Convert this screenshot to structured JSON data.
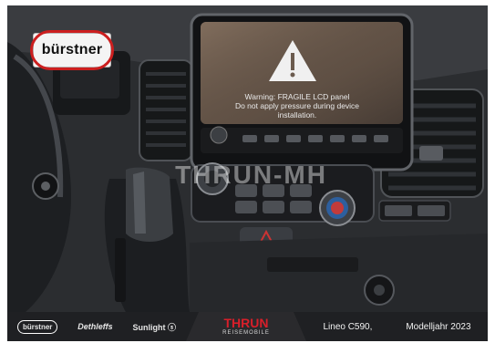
{
  "image": {
    "brand_logo_text": "bürstner",
    "screen_warning": {
      "line1": "Warning: FRAGILE LCD panel",
      "line2": "Do not apply pressure during device installation."
    },
    "watermark_text": "THRUN-MH"
  },
  "footer": {
    "logos": {
      "burstner": "bürstner",
      "dethleffs": "Dethleffs",
      "sunlight": "Sunlight ⓢ"
    },
    "thrun": {
      "title": "THRUN",
      "subtitle": "REISEMOBILE"
    },
    "model": "Lineo C590,",
    "year_label": "Modelljahr 2023"
  }
}
